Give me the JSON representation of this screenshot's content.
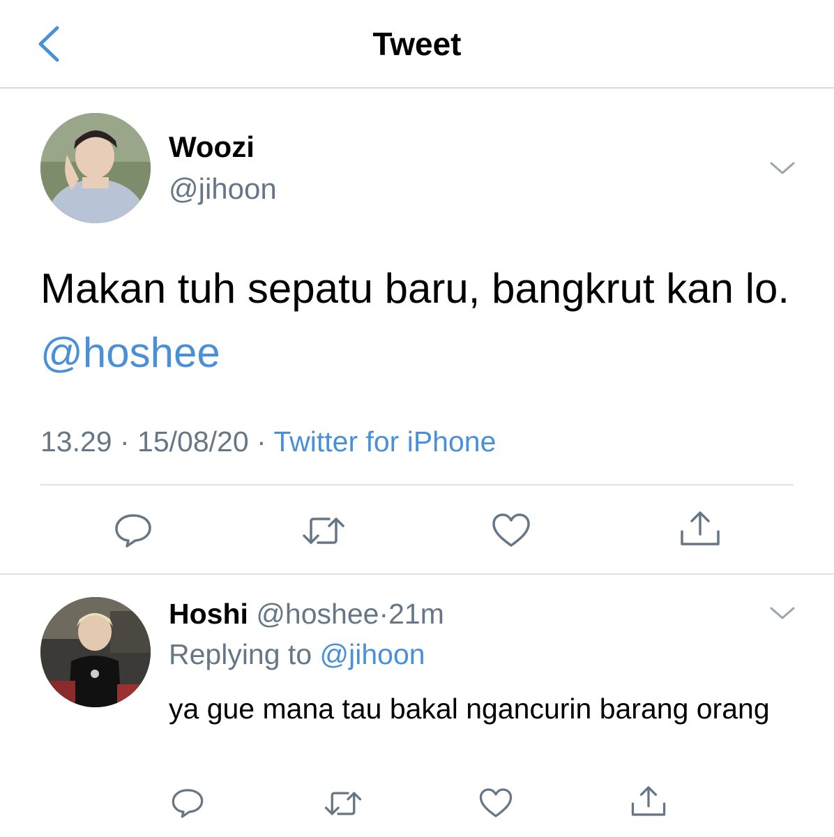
{
  "header": {
    "title": "Tweet",
    "back_icon": "chevron-left-icon"
  },
  "colors": {
    "accent": "#4a90d9",
    "secondary_text": "#657786",
    "divider": "#e1e1e1"
  },
  "tweet": {
    "display_name": "Woozi",
    "handle": "@jihoon",
    "text": "Makan tuh sepatu baru, bangkrut kan lo. ",
    "mention": "@hoshee",
    "time": "13.29",
    "sep1": " · ",
    "date": "15/08/20",
    "sep2": " · ",
    "source": "Twitter for iPhone",
    "actions": [
      "reply-icon",
      "retweet-icon",
      "like-icon",
      "share-icon"
    ]
  },
  "reply": {
    "display_name": "Hoshi",
    "handle": "@hoshee",
    "dot": "·",
    "time": "21m",
    "replying_prefix": "Replying to ",
    "replying_to": "@jihoon",
    "text": "ya gue mana tau bakal ngancurin barang orang",
    "actions": [
      "reply-icon",
      "retweet-icon",
      "like-icon",
      "share-icon"
    ]
  }
}
